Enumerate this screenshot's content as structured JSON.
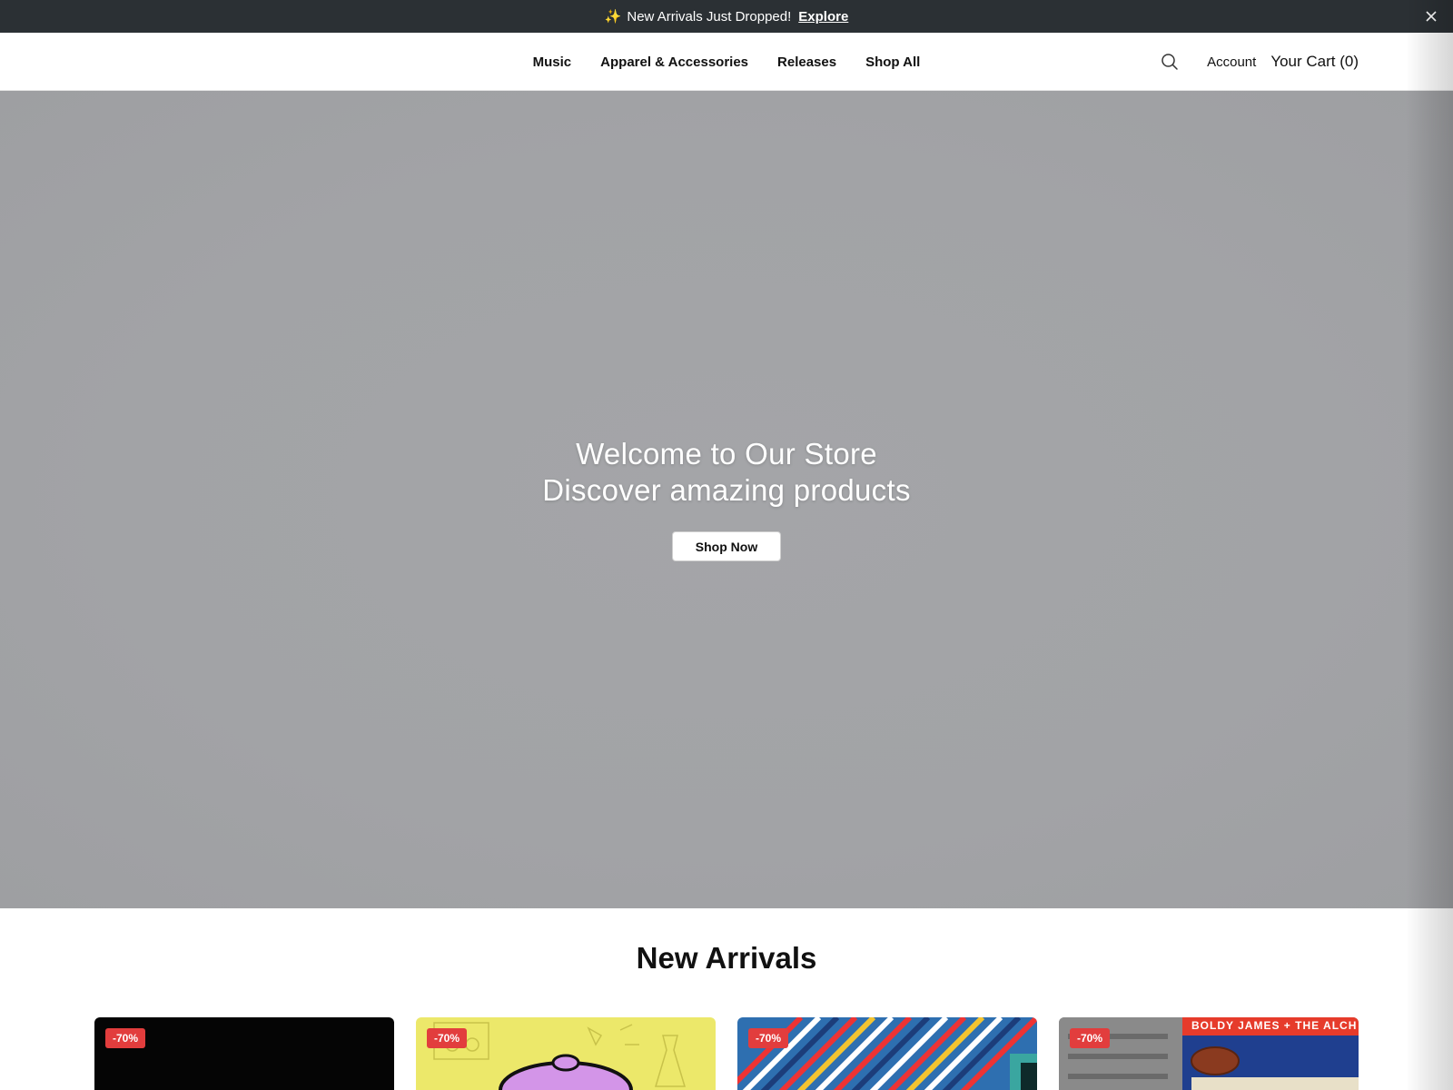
{
  "announcement": {
    "message": "New Arrivals Just Dropped!",
    "link_label": "Explore",
    "icon": "sparkles-icon",
    "close_icon": "close-icon"
  },
  "nav": {
    "items": [
      "Music",
      "Apparel & Accessories",
      "Releases",
      "Shop All"
    ]
  },
  "header": {
    "search_icon": "search-icon",
    "account_label": "Account",
    "cart_label": "Your Cart (0)"
  },
  "hero": {
    "line1": "Welcome to Our Store",
    "line2": "Discover amazing products",
    "cta_label": "Shop Now"
  },
  "new_arrivals": {
    "title": "New Arrivals",
    "products": [
      {
        "badge": "-70%"
      },
      {
        "badge": "-70%"
      },
      {
        "badge": "-70%"
      },
      {
        "badge": "-70%",
        "cover_text": "BOLDY JAMES + THE ALCH"
      }
    ]
  },
  "colors": {
    "announcement_bg": "#2b3034",
    "badge_bg": "#e23d3d",
    "hero_bg": "#a3a4a7"
  }
}
